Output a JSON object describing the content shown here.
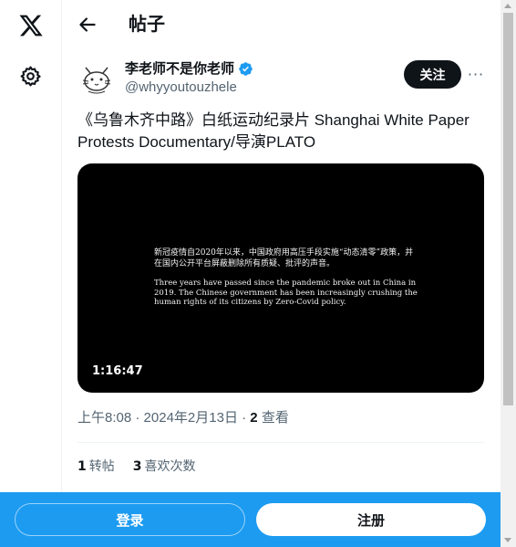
{
  "header": {
    "title": "帖子"
  },
  "author": {
    "display_name": "李老师不是你老师",
    "handle": "@whyyoutouzhele",
    "verified": true
  },
  "actions": {
    "follow_label": "关注",
    "more_label": "···"
  },
  "post": {
    "text": "《乌鲁木齐中路》白纸运动纪录片 Shanghai White Paper Protests Documentary/导演PLATO",
    "video": {
      "caption_cn": "新冠疫情自2020年以来，中国政府用高压手段实施“动态清零”政策，并在国内公开平台屏蔽删除所有质疑、批评的声音。",
      "caption_en": "Three years have passed since the pandemic broke out in China in 2019. The Chinese government has been increasingly crushing the human rights of its citizens by Zero-Covid policy.",
      "duration": "1:16:47"
    },
    "time": "上午8:08",
    "date": "2024年2月13日",
    "view_count": "2",
    "view_label": "查看",
    "separator": "·"
  },
  "stats": {
    "retweets_count": "1",
    "retweets_label": "转帖",
    "quotes_count": "3",
    "quotes_label": "喜欢次数"
  },
  "bottom_bar": {
    "login_label": "登录",
    "signup_label": "注册"
  },
  "colors": {
    "accent": "#1d9bf0",
    "text": "#0f1419",
    "muted": "#536471"
  },
  "icons": [
    "x-logo-icon",
    "gear-icon",
    "back-arrow-icon",
    "verified-badge-icon",
    "more-icon"
  ]
}
